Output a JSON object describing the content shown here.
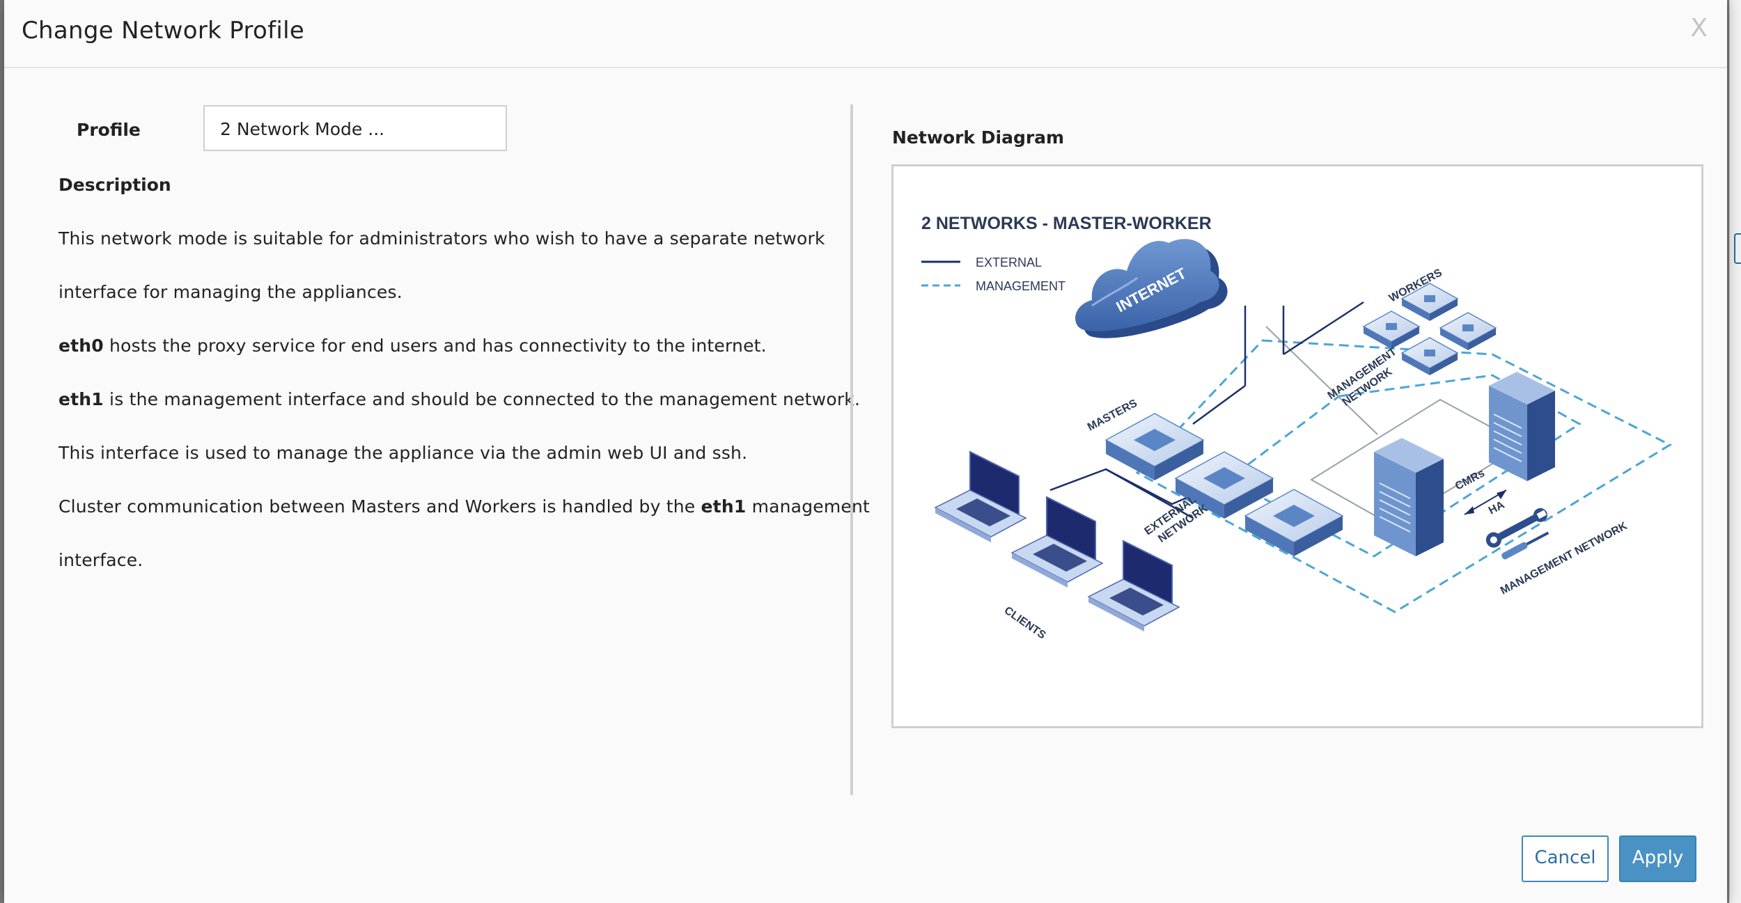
{
  "dialog": {
    "title": "Change Network Profile",
    "close_label": "X"
  },
  "form": {
    "profile_label": "Profile",
    "profile_value": "2 Network Mode ...",
    "description_label": "Description",
    "description_lines": [
      {
        "bold": "",
        "text": "This network mode is suitable for administrators who wish to have a separate network"
      },
      {
        "bold": "",
        "text": "interface for managing the appliances."
      },
      {
        "bold": "eth0",
        "text": " hosts the proxy service for end users and has connectivity to the internet."
      },
      {
        "bold": "eth1",
        "text": " is the management interface and should be connected to the management network."
      },
      {
        "bold": "",
        "text": "This interface is used to manage the appliance via the admin web UI and ssh."
      },
      {
        "bold": "",
        "text": "Cluster communication between Masters and Workers is handled by the ",
        "bold_mid": "eth1",
        "text_after": " management"
      },
      {
        "bold": "",
        "text": "interface."
      }
    ]
  },
  "diagram": {
    "section_label": "Network Diagram",
    "title": "2 NETWORKS - MASTER-WORKER",
    "legend": [
      {
        "label": "EXTERNAL",
        "style": "solid",
        "color": "#1c2f6a"
      },
      {
        "label": "MANAGEMENT",
        "style": "dashed",
        "color": "#4aa6d6"
      }
    ],
    "labels": {
      "internet": "INTERNET",
      "workers": "WORKERS",
      "management_network_top": "MANAGEMENT",
      "management_network_top2": "NETWORK",
      "masters": "MASTERS",
      "external_network": "EXTERNAL",
      "external_network2": "NETWORK",
      "cmrs": "CMRs",
      "ha": "HA",
      "management_network_bottom": "MANAGEMENT NETWORK",
      "clients": "CLIENTS"
    },
    "colors": {
      "dark_navy": "#1c2f6a",
      "mgmt_blue": "#4aa6d6",
      "device_blue": "#5b86c6",
      "device_light": "#dce6f5"
    }
  },
  "buttons": {
    "cancel": "Cancel",
    "apply": "Apply"
  }
}
